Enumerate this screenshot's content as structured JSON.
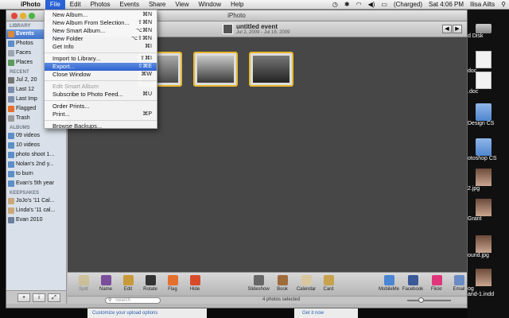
{
  "menubar": {
    "app": "iPhoto",
    "items": [
      "File",
      "Edit",
      "Photos",
      "Events",
      "Share",
      "View",
      "Window",
      "Help"
    ],
    "active": "File",
    "battery": "(Charged)",
    "clock": "Sat 4:06 PM",
    "user": "Ilisa Ailts"
  },
  "window": {
    "title": "iPhoto"
  },
  "sidebar": {
    "library_head": "LIBRARY",
    "library": [
      {
        "label": "Events",
        "color": "#d8893a"
      },
      {
        "label": "Photos",
        "color": "#5c8fc9"
      },
      {
        "label": "Faces",
        "color": "#9aa5b0"
      },
      {
        "label": "Places",
        "color": "#5a9a5a"
      }
    ],
    "recent_head": "RECENT",
    "recent": [
      {
        "label": "Jul 2, 20",
        "color": "#777"
      },
      {
        "label": "Last 12",
        "color": "#7a8fae"
      },
      {
        "label": "Last Imp",
        "color": "#7a8fae"
      },
      {
        "label": "Flagged",
        "color": "#e6702e"
      },
      {
        "label": "Trash",
        "color": "#999"
      }
    ],
    "albums_head": "ALBUMS",
    "albums": [
      {
        "label": "09 videos",
        "color": "#5c8fc9"
      },
      {
        "label": "10 videos",
        "color": "#5c8fc9"
      },
      {
        "label": "photo shoot 1...",
        "color": "#5c8fc9"
      },
      {
        "label": "Nolan's 2nd y...",
        "color": "#5c8fc9"
      },
      {
        "label": "to burn",
        "color": "#5c8fc9"
      },
      {
        "label": "Evan's 5th year",
        "color": "#5c8fc9"
      }
    ],
    "keepsakes_head": "KEEPSAKES",
    "keepsakes": [
      {
        "label": "JoJo's '11 Cal...",
        "color": "#c9a97a"
      },
      {
        "label": "Linda's '11 cal...",
        "color": "#c9a97a"
      },
      {
        "label": "Evan 2010",
        "color": "#6c7f9c"
      }
    ],
    "bottom_buttons": [
      "+",
      "i",
      "⤢"
    ]
  },
  "event": {
    "title": "untitled event",
    "date": "Jul 2, 2009 - Jul 19, 2009",
    "count": "4 photos selected"
  },
  "photos": [
    {
      "name": "photo-1",
      "colors": [
        "#a8a8a8",
        "#4a4a4a"
      ]
    },
    {
      "name": "photo-2",
      "colors": [
        "#c8c8c8",
        "#3a3a3a"
      ]
    },
    {
      "name": "photo-3",
      "colors": [
        "#777777",
        "#222222"
      ]
    }
  ],
  "toolbar": {
    "left": [
      {
        "label": "Split",
        "icon": "split-icon",
        "disabled": true
      },
      {
        "label": "Name",
        "icon": "name-icon"
      },
      {
        "label": "Edit",
        "icon": "edit-icon"
      },
      {
        "label": "Rotate",
        "icon": "rotate-icon"
      },
      {
        "label": "Flag",
        "icon": "flag-icon"
      },
      {
        "label": "Hide",
        "icon": "hide-icon"
      }
    ],
    "center": [
      {
        "label": "Slideshow",
        "icon": "slideshow-icon"
      },
      {
        "label": "Book",
        "icon": "book-icon"
      },
      {
        "label": "Calendar",
        "icon": "calendar-icon"
      },
      {
        "label": "Card",
        "icon": "card-icon"
      }
    ],
    "right": [
      {
        "label": "MobileMe",
        "icon": "mobileme-icon"
      },
      {
        "label": "Facebook",
        "icon": "facebook-icon"
      },
      {
        "label": "Flickr",
        "icon": "flickr-icon"
      },
      {
        "label": "Email",
        "icon": "email-icon"
      }
    ]
  },
  "search": {
    "placeholder": "Search"
  },
  "bottom": {
    "left_link": "Customize your upload options",
    "right_link": "Get it now"
  },
  "desktop": [
    {
      "label": "d Disk",
      "kind": "disk"
    },
    {
      "label": "doc",
      "kind": "doc"
    },
    {
      "label": ".doc",
      "kind": "doc"
    },
    {
      "label": "Design CS",
      "kind": "folder"
    },
    {
      "label": "otoshop CS",
      "kind": "folder"
    },
    {
      "label": "2.jpg",
      "kind": "photo"
    },
    {
      "label": "Grant",
      "kind": "photo"
    },
    {
      "label": "ound.jpg",
      "kind": "photo"
    },
    {
      "label": "og\nand-1.indd",
      "kind": "photo"
    }
  ],
  "file_menu": [
    {
      "label": "New Album...",
      "shortcut": "⌘N"
    },
    {
      "label": "New Album From Selection...",
      "shortcut": "⇧⌘N"
    },
    {
      "label": "New Smart Album...",
      "shortcut": "⌥⌘N"
    },
    {
      "label": "New Folder",
      "shortcut": "⌥⇧⌘N"
    },
    {
      "label": "Get Info",
      "shortcut": "⌘I"
    },
    {
      "sep": true
    },
    {
      "label": "Import to Library...",
      "shortcut": "⇧⌘I"
    },
    {
      "label": "Export...",
      "shortcut": "⇧⌘E",
      "selected": true
    },
    {
      "label": "Close Window",
      "shortcut": "⌘W"
    },
    {
      "sep": true
    },
    {
      "label": "Edit Smart Album",
      "shortcut": "",
      "disabled": true
    },
    {
      "label": "Subscribe to Photo Feed...",
      "shortcut": "⌘U"
    },
    {
      "sep": true
    },
    {
      "label": "Order Prints...",
      "shortcut": ""
    },
    {
      "label": "Print...",
      "shortcut": "⌘P"
    },
    {
      "sep": true
    },
    {
      "label": "Browse Backups...",
      "shortcut": ""
    }
  ]
}
